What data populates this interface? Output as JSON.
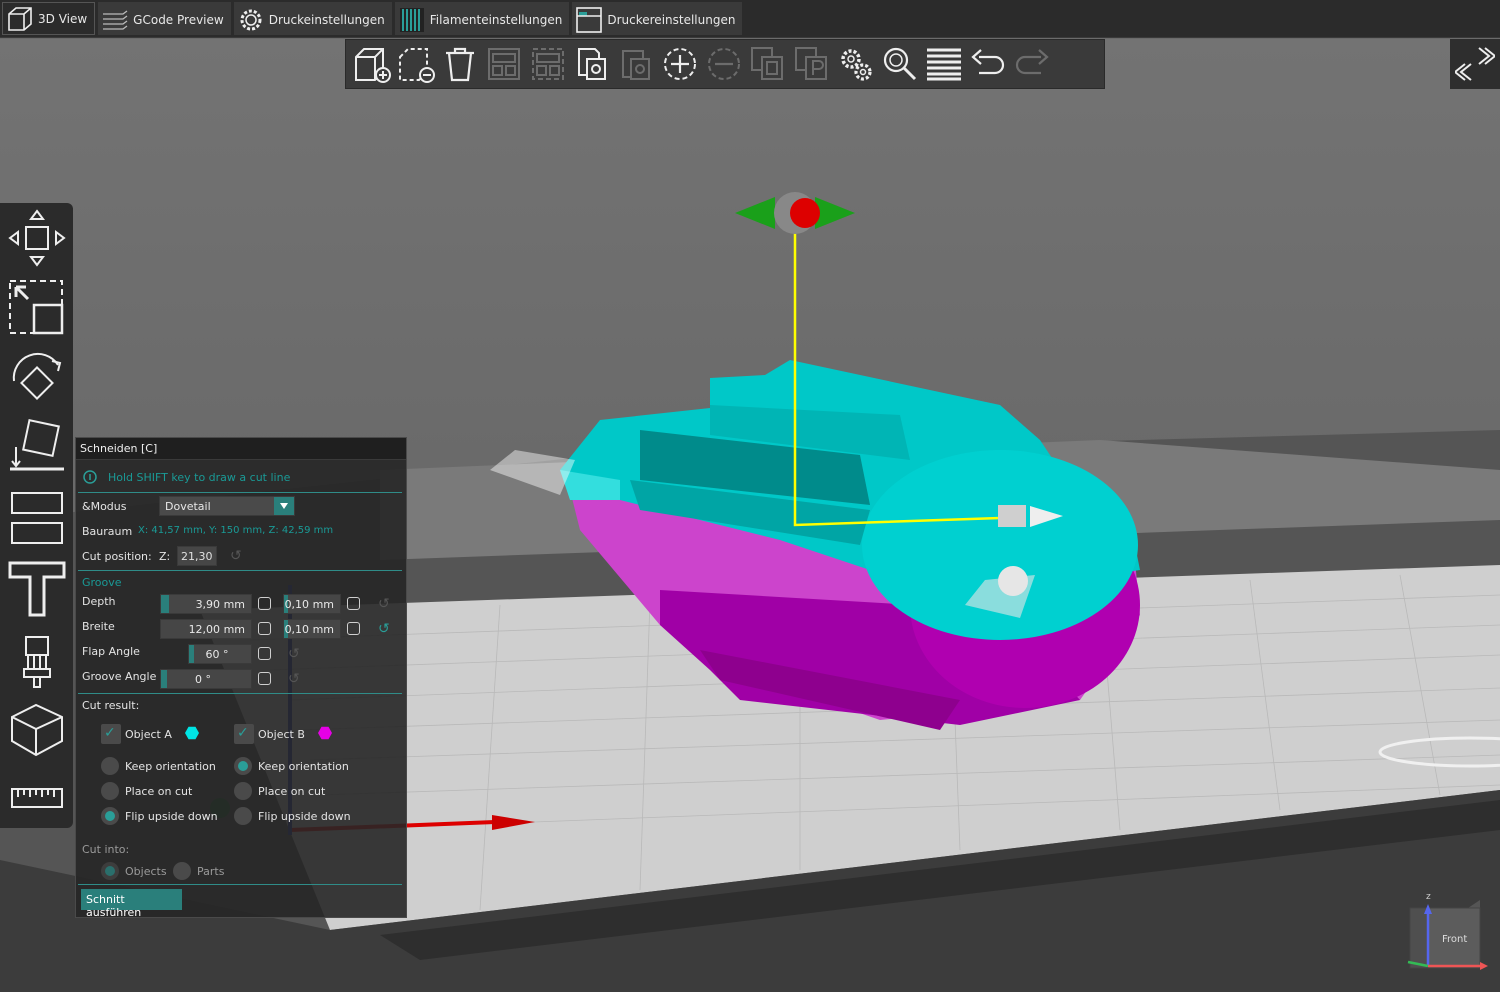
{
  "tabs": [
    {
      "label": "3D View",
      "icon": "cube-icon",
      "active": true
    },
    {
      "label": "GCode Preview",
      "icon": "layers-icon"
    },
    {
      "label": "Druckeinstellungen",
      "icon": "gear-icon"
    },
    {
      "label": "Filamenteinstellungen",
      "icon": "filament-icon"
    },
    {
      "label": "Druckereinstellungen",
      "icon": "printer-icon"
    }
  ],
  "toolbar": {
    "items": [
      "add-icon",
      "delete-icon",
      "delete-all-icon",
      "arrange-icon",
      "arrange-selection-icon",
      "copy-icon",
      "paste-icon",
      "add-instance-icon",
      "remove-instance-icon",
      "split-objects-icon",
      "split-parts-icon",
      "settings-icon",
      "search-icon",
      "layers-editing-icon",
      "undo-icon",
      "redo-icon"
    ]
  },
  "panel": {
    "title": "Schneiden [C]",
    "hint": "Hold SHIFT key to draw a cut line",
    "mode_label": "&Modus",
    "mode_value": "Dovetail",
    "bauraum_label": "Bauraum",
    "bauraum_value": "X: 41,57 mm,  Y: 150 mm,  Z: 42,59 mm",
    "cut_position_label": "Cut position:",
    "z_label": "Z:",
    "z_value": "21,30",
    "groove_label": "Groove",
    "depth_label": "Depth",
    "depth_value": "3,90",
    "depth_unit": "mm",
    "depth_tol": "0,10",
    "depth_tol_unit": "mm",
    "width_label": "Breite",
    "width_value": "12,00",
    "width_unit": "mm",
    "width_tol": "0,10",
    "width_tol_unit": "mm",
    "flap_label": "Flap Angle",
    "flap_value": "60 °",
    "groove_angle_label": "Groove Angle",
    "groove_angle_value": "0 °",
    "cut_result_label": "Cut result:",
    "object_a": "Object A",
    "object_b": "Object B",
    "object_a_color": "#00e5e5",
    "object_b_color": "#e600e6",
    "keep_orientation": "Keep orientation",
    "place_on_cut": "Place on cut",
    "flip_upside_down": "Flip upside down",
    "cut_into_label": "Cut into:",
    "objects": "Objects",
    "parts": "Parts",
    "apply": "Schnitt ausführen"
  },
  "viewcube": {
    "face": "Front",
    "axis_z": "z",
    "axis_x": "x",
    "axis_y": "y"
  },
  "colors": {
    "accent": "#2a7f7b",
    "object_a": "#00cccc",
    "object_b": "#b000b0"
  }
}
